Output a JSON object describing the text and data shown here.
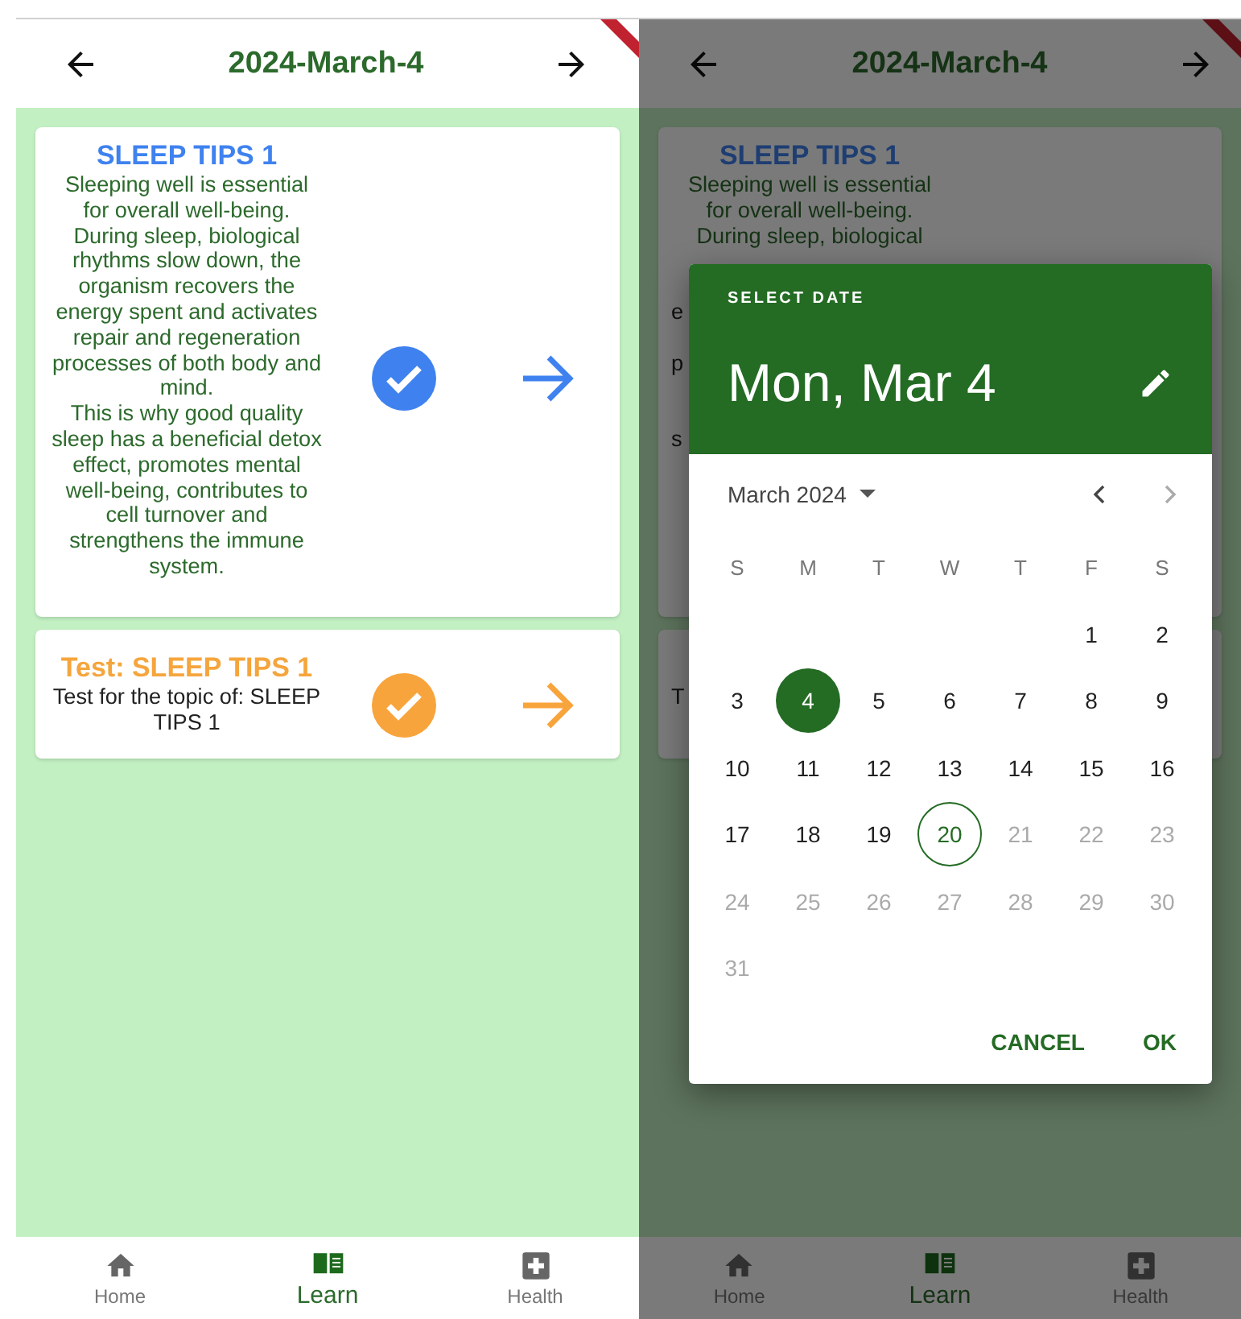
{
  "screens": [
    {
      "header": {
        "title": "2024-March-4"
      },
      "lessons": [
        {
          "kind": "lesson",
          "title": "SLEEP TIPS 1",
          "completed": true,
          "description_lines": [
            "Sleeping well is essential",
            "for overall well-being.",
            "During sleep, biological",
            "rhythms slow down, the",
            "organism recovers the",
            "energy spent and activates",
            "repair and regeneration",
            "processes of both body and",
            "mind.",
            "This is why good quality",
            "sleep has a beneficial detox",
            "effect, promotes mental",
            "well-being, contributes to",
            "cell turnover and",
            "strengthens the immune",
            "system."
          ]
        },
        {
          "kind": "test",
          "title": "Test: SLEEP TIPS 1",
          "completed": true,
          "description_lines": [
            "Test for the topic of: SLEEP",
            "TIPS 1"
          ]
        }
      ],
      "nav": [
        {
          "label": "Home",
          "kind": "home",
          "selected": false
        },
        {
          "label": "Learn",
          "kind": "book",
          "selected": true
        },
        {
          "label": "Health",
          "kind": "health",
          "selected": false
        }
      ]
    },
    {
      "header": {
        "title": "2024-March-4"
      },
      "lessons": [
        {
          "kind": "covered-lesson",
          "title": "SLEEP TIPS 1",
          "description_lines": [
            "Sleeping well is essential",
            "for overall well-being.",
            "During sleep, biological"
          ],
          "covered_line_starts": [
            "e",
            "p",
            "s"
          ]
        },
        {
          "kind": "covered-test",
          "covered_line_starts": [
            "T"
          ]
        }
      ],
      "nav": [
        {
          "label": "Home",
          "kind": "home",
          "selected": false
        },
        {
          "label": "Learn",
          "kind": "book",
          "selected": true
        },
        {
          "label": "Health",
          "kind": "health",
          "selected": false
        }
      ],
      "date_picker": {
        "heading": "SELECT DATE",
        "selected_date": "Mon, Mar 4",
        "month": "March 2024",
        "next_disabled": true,
        "weekdays": [
          "S",
          "M",
          "T",
          "W",
          "T",
          "F",
          "S"
        ],
        "days": [
          {
            "label": "1",
            "selected": false,
            "today": false,
            "disabled": false
          },
          {
            "label": "2",
            "selected": false,
            "today": false,
            "disabled": false
          },
          {
            "label": "3",
            "selected": false,
            "today": false,
            "disabled": false
          },
          {
            "label": "4",
            "selected": true,
            "today": false,
            "disabled": false
          },
          {
            "label": "5",
            "selected": false,
            "today": false,
            "disabled": false
          },
          {
            "label": "6",
            "selected": false,
            "today": false,
            "disabled": false
          },
          {
            "label": "7",
            "selected": false,
            "today": false,
            "disabled": false
          },
          {
            "label": "8",
            "selected": false,
            "today": false,
            "disabled": false
          },
          {
            "label": "9",
            "selected": false,
            "today": false,
            "disabled": false
          },
          {
            "label": "10",
            "selected": false,
            "today": false,
            "disabled": false
          },
          {
            "label": "11",
            "selected": false,
            "today": false,
            "disabled": false
          },
          {
            "label": "12",
            "selected": false,
            "today": false,
            "disabled": false
          },
          {
            "label": "13",
            "selected": false,
            "today": false,
            "disabled": false
          },
          {
            "label": "14",
            "selected": false,
            "today": false,
            "disabled": false
          },
          {
            "label": "15",
            "selected": false,
            "today": false,
            "disabled": false
          },
          {
            "label": "16",
            "selected": false,
            "today": false,
            "disabled": false
          },
          {
            "label": "17",
            "selected": false,
            "today": false,
            "disabled": false
          },
          {
            "label": "18",
            "selected": false,
            "today": false,
            "disabled": false
          },
          {
            "label": "19",
            "selected": false,
            "today": false,
            "disabled": false
          },
          {
            "label": "20",
            "selected": false,
            "today": true,
            "disabled": false
          },
          {
            "label": "21",
            "selected": false,
            "today": false,
            "disabled": true
          },
          {
            "label": "22",
            "selected": false,
            "today": false,
            "disabled": true
          },
          {
            "label": "23",
            "selected": false,
            "today": false,
            "disabled": true
          },
          {
            "label": "24",
            "selected": false,
            "today": false,
            "disabled": true
          },
          {
            "label": "25",
            "selected": false,
            "today": false,
            "disabled": true
          },
          {
            "label": "26",
            "selected": false,
            "today": false,
            "disabled": true
          },
          {
            "label": "27",
            "selected": false,
            "today": false,
            "disabled": true
          },
          {
            "label": "28",
            "selected": false,
            "today": false,
            "disabled": true
          },
          {
            "label": "29",
            "selected": false,
            "today": false,
            "disabled": true
          },
          {
            "label": "30",
            "selected": false,
            "today": false,
            "disabled": true
          },
          {
            "label": "31",
            "selected": false,
            "today": false,
            "disabled": true
          }
        ],
        "buttons": [
          "CANCEL",
          "OK"
        ]
      }
    }
  ]
}
